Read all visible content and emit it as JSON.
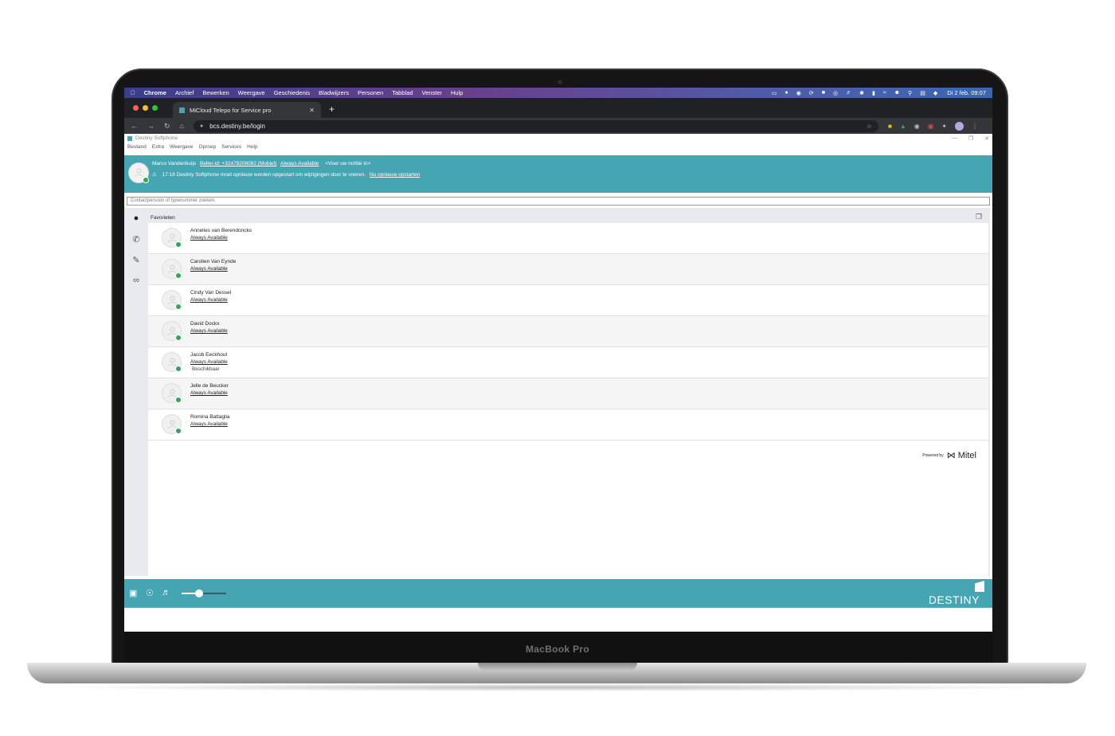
{
  "device": {
    "model": "MacBook Pro"
  },
  "menubar": {
    "app": "Chrome",
    "items": [
      "Archief",
      "Bewerken",
      "Weergave",
      "Geschiedenis",
      "Bladwijzers",
      "Personen",
      "Tabblad",
      "Venster",
      "Hulp"
    ],
    "clock": "Di 2 feb. 09:07"
  },
  "browser": {
    "tab_title": "MiCloud Telepo for Service pro",
    "url": "bcs.destiny.be/login"
  },
  "app": {
    "window_title": "Destiny Softphone",
    "menu": [
      "Bestand",
      "Extra",
      "Weergave",
      "Oproep",
      "Services",
      "Help"
    ],
    "user": {
      "name": "Marco Vandenbuijs",
      "caller_id": "Beller-id: +32478208082 (Mobiel)",
      "status": "Always Available",
      "note": "<Voer uw notitie in>"
    },
    "notice": {
      "time": "17:18",
      "text": "Destiny Softphone moet opnieuw worden opgestart om wijzigingen door te voeren.",
      "link": "Nu opnieuw opstarten"
    },
    "search_placeholder": "Contactpersoon of typenummer zoeken.",
    "favorites_label": "Favorieten",
    "contacts": [
      {
        "name": "Annelies van Berendoncks",
        "status": "Always Available"
      },
      {
        "name": "Carolien Van Eynde",
        "status": "Always Available"
      },
      {
        "name": "Cindy Van Dessel",
        "status": "Always Available"
      },
      {
        "name": "David Dockx",
        "status": "Always Available"
      },
      {
        "name": "Jacob Eeckhout",
        "status": "Always Available",
        "sub": "Beschikbaar"
      },
      {
        "name": "Jelle de Beucker",
        "status": "Always Available"
      },
      {
        "name": "Romina Battaglia",
        "status": "Always Available"
      }
    ],
    "powered_by": "Powered by",
    "powered_logo": "Mitel",
    "brand": "DESTINY",
    "volume_level": 0.4
  },
  "colors": {
    "accent": "#45a5b3",
    "online": "#2fa84f"
  }
}
